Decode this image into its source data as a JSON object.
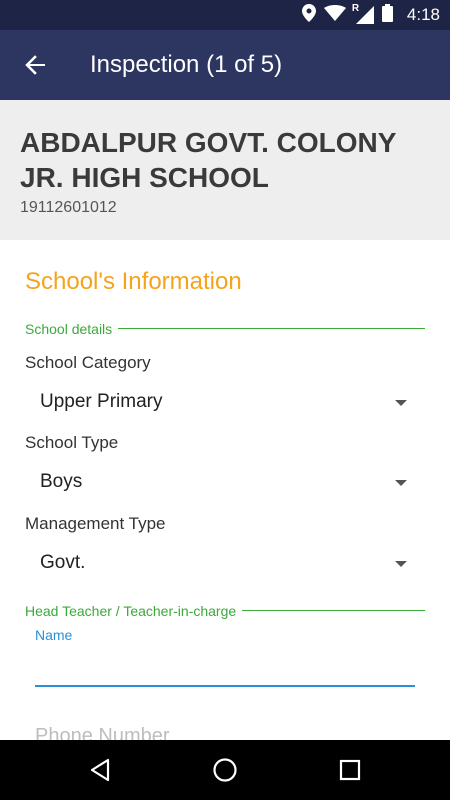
{
  "status_bar": {
    "time": "4:18",
    "icons": [
      "location-icon",
      "wifi-icon",
      "signal-roaming-icon",
      "battery-icon"
    ],
    "roaming_label": "R"
  },
  "app_bar": {
    "title": "Inspection (1 of 5)",
    "back_icon": "arrow-back-icon"
  },
  "school": {
    "name": "ABDALPUR GOVT. COLONY JR. HIGH SCHOOL",
    "code": "19112601012"
  },
  "section": {
    "title": "School's Information"
  },
  "school_details": {
    "group_label": "School details",
    "category_label": "School Category",
    "category_value": "Upper Primary",
    "type_label": "School Type",
    "type_value": "Boys",
    "management_label": "Management Type",
    "management_value": "Govt."
  },
  "head_teacher": {
    "group_label": "Head Teacher / Teacher-in-charge",
    "name_label": "Name",
    "name_value": "",
    "phone_hint": "Phone Number"
  },
  "nav_bar": {
    "icons": [
      "back-triangle-icon",
      "home-circle-icon",
      "recents-square-icon"
    ]
  },
  "colors": {
    "status_bar": "#1e2445",
    "app_bar": "#2d3561",
    "section_title": "#f5a31a",
    "group_label": "#3aaa3a",
    "input_accent": "#2a8fd8"
  }
}
